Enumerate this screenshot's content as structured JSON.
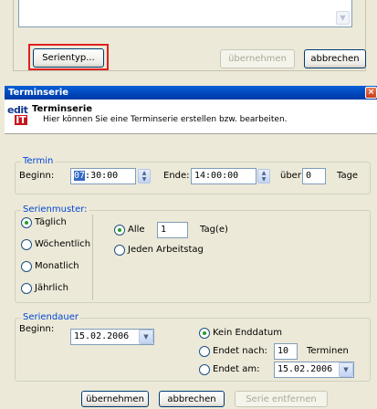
{
  "top_dialog": {
    "serientyp_button": "Serientyp...",
    "uebernehmen_button": "übernehmen",
    "abbrechen_button": "abbrechen"
  },
  "dialog": {
    "title": "Terminserie",
    "close_glyph": "×",
    "header": {
      "logo_top": "edit",
      "logo_bottom": "IT",
      "title": "Terminserie",
      "subtitle": "Hier können Sie eine Terminserie erstellen bzw. bearbeiten."
    },
    "termin": {
      "group_title": "Termin",
      "beginn_label": "Beginn:",
      "beginn_caret": "07",
      "beginn_rest": ":30:00",
      "ende_label": "Ende:",
      "ende_value": "14:00:00",
      "ueber_label": "über",
      "tage_value": "0",
      "tage_label": "Tage"
    },
    "serienmuster": {
      "group_title": "Serienmuster:",
      "options": [
        "Täglich",
        "Wöchentlich",
        "Monatlich",
        "Jährlich"
      ],
      "selected": "Täglich",
      "alle_label": "Alle",
      "alle_value": "1",
      "tage_unit": "Tag(e)",
      "jeden_arbeitstag": "Jeden Arbeitstag"
    },
    "seriendauer": {
      "group_title": "Seriendauer",
      "beginn_label": "Beginn:",
      "beginn_value": "15.02.2006",
      "kein_enddatum": "Kein Enddatum",
      "endet_nach": "Endet nach:",
      "endet_nach_value": "10",
      "terminen": "Terminen",
      "endet_am": "Endet am:",
      "endet_am_value": "15.02.2006"
    },
    "footer": {
      "uebernehmen": "übernehmen",
      "abbrechen": "abbrechen",
      "serie_entfernen": "Serie entfernen"
    }
  },
  "colors": {
    "highlight": "#e02020",
    "titlebar": "#0050c8",
    "group_title": "#0046d5"
  }
}
